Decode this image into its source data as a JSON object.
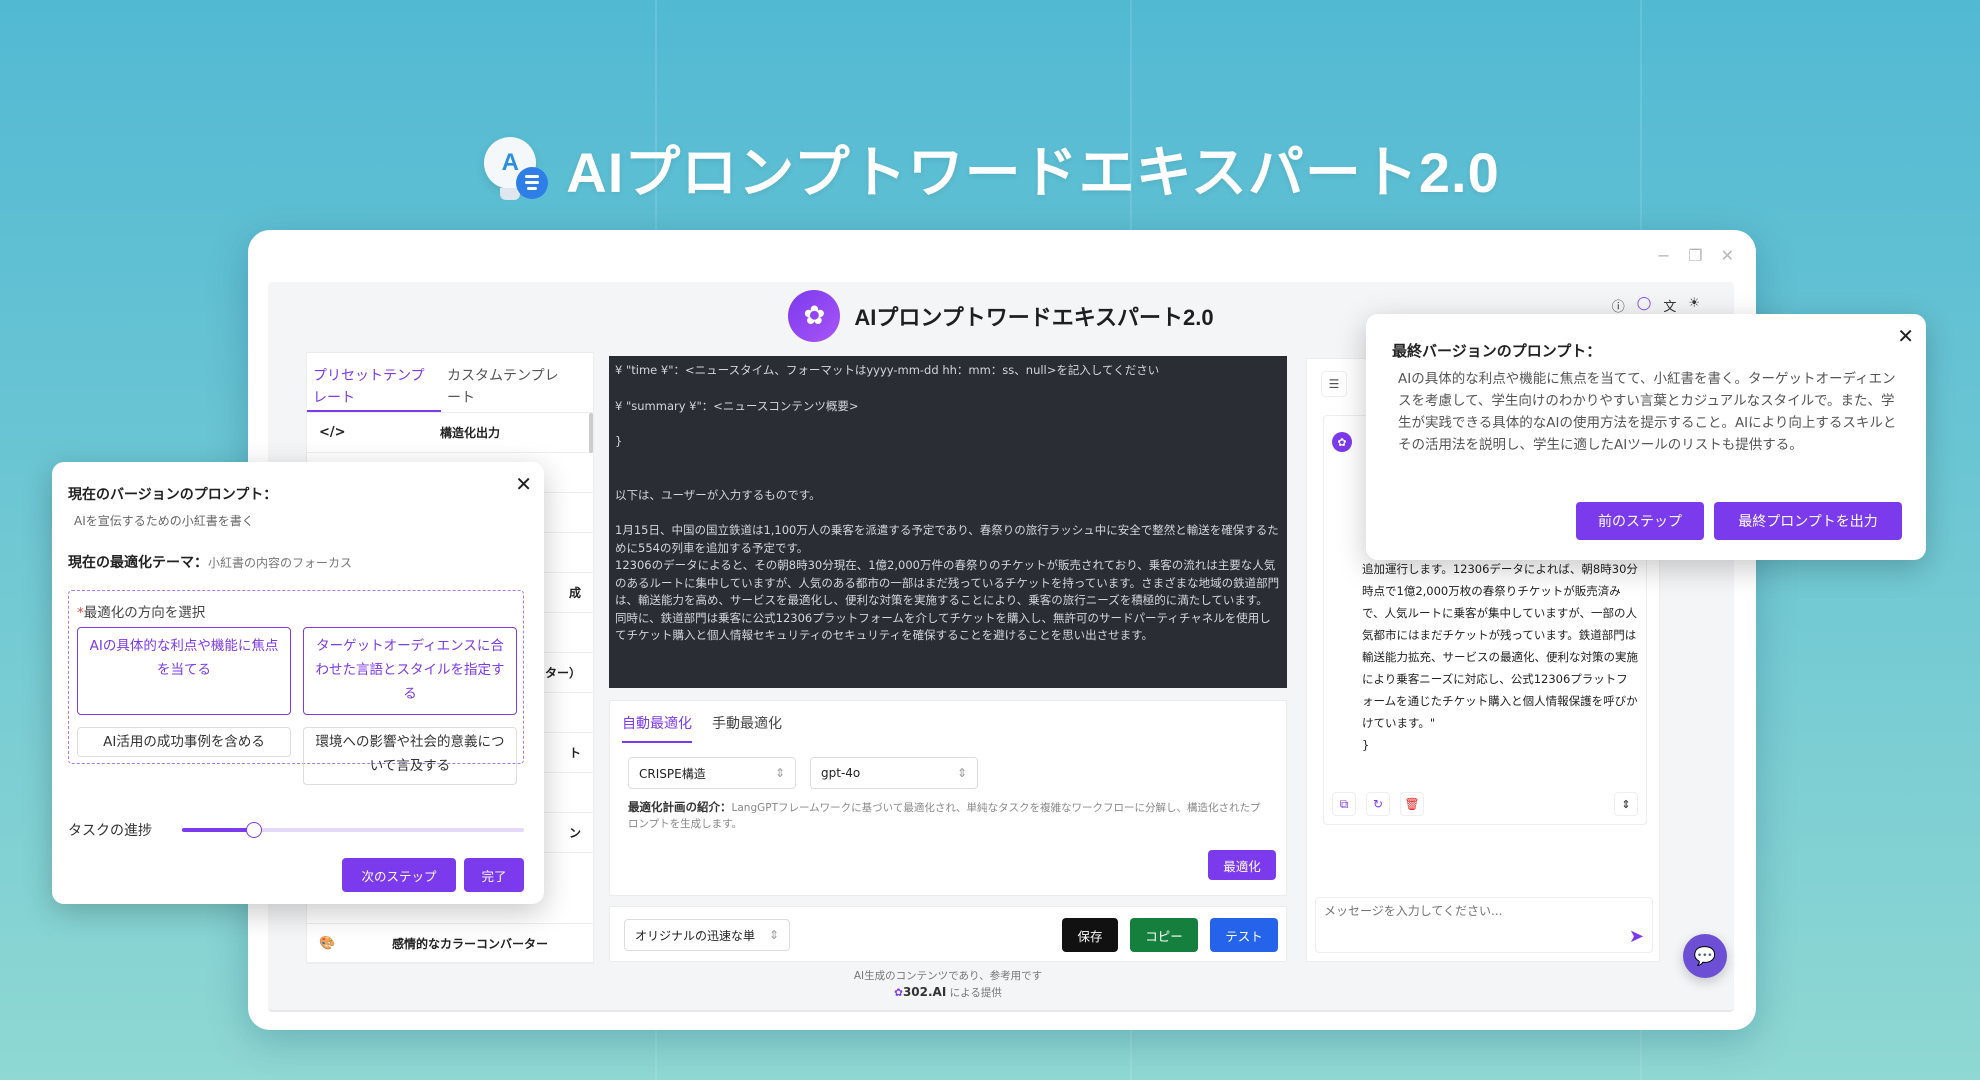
{
  "hero": {
    "title": "AIプロンプトワードエキスパート2.0",
    "logo_letter": "A"
  },
  "window": {
    "controls": [
      "−",
      "❐",
      "✕"
    ]
  },
  "app": {
    "title": "AIプロンプトワードエキスパート2.0",
    "header_icons": [
      "ⓘ",
      "◯",
      "文",
      "☀"
    ]
  },
  "left_panel": {
    "tabs": [
      "プリセットテンプレート",
      "カスタムテンプレート"
    ],
    "items": [
      {
        "icon": "</>",
        "name": "構造化出力"
      },
      {
        "icon": "",
        "name": ""
      },
      {
        "icon": "",
        "name": ""
      },
      {
        "icon": "",
        "name": ""
      },
      {
        "icon": "",
        "name": ""
      },
      {
        "icon": "",
        "name": ""
      },
      {
        "icon": "",
        "name": ""
      },
      {
        "icon": "",
        "name": ""
      },
      {
        "icon": "",
        "name": ""
      },
      {
        "icon": "",
        "name": ""
      },
      {
        "icon": "",
        "name": ""
      },
      {
        "icon": "🎨",
        "name": "感情的なカラーコンバーター"
      }
    ],
    "partial_texts": [
      "成",
      "ター）",
      "ト",
      "ン"
    ]
  },
  "editor": {
    "lines": [
      "¥ \"time ¥\"：<ニュースタイム、フォーマットはyyyy-mm-dd hh：mm：ss、null>を記入してください",
      "",
      "¥ \"summary ¥\"：<ニュースコンテンツ概要>",
      "",
      "}",
      "",
      "",
      "以下は、ユーザーが入力するものです。",
      "",
      "1月15日、中国の国立鉄道は1,100万人の乗客を派遣する予定であり、春祭りの旅行ラッシュ中に安全で整然と輸送を確保するために554の列車を追加する予定です。",
      "12306のデータによると、その朝8時30分現在、1億2,000万件の春祭りのチケットが販売されており、乗客の流れは主要な人気のあるルートに集中していますが、人気のある都市の一部はまだ残っているチケットを持っています。さまざまな地域の鉄道部門は、輸送能力を高め、サービスを最適化し、便利な対策を実施することにより、乗客の旅行ニーズを積極的に満たしています。",
      "同時に、鉄道部門は乗客に公式12306プラットフォームを介してチケットを購入し、無許可のサードパーティチャネルを使用してチケット購入と個人情報セキュリティのセキュリティを確保することを避けることを思い出させます。"
    ]
  },
  "optimization": {
    "tabs": [
      "自動最適化",
      "手動最適化"
    ],
    "framework_select": "CRISPE構造",
    "model_select": "gpt-4o",
    "plan_label": "最適化計画の紹介：",
    "plan_text": "LangGPTフレームワークに基づいて最適化され、単純なタスクを複雑なワークフローに分解し、構造化されたプロンプトを生成します。",
    "optimize_button": "最適化"
  },
  "bottom_bar": {
    "select": "オリジナルの迅速な単",
    "save": "保存",
    "copy": "コピー",
    "test": "テスト"
  },
  "right_panel": {
    "chat_text": "追加運行します。12306データによれば、朝8時30分時点で1億2,000万枚の春祭りチケットが販売済みで、人気ルートに乗客が集中していますが、一部の人気都市にはまだチケットが残っています。鉄道部門は輸送能力拡充、サービスの最適化、便利な対策の実施により乗客ニーズに対応し、公式12306プラットフォームを通じたチケット購入と個人情報保護を呼びかけています。\"",
    "chat_closing": "}",
    "message_placeholder": "メッセージを入力してください..."
  },
  "footer": {
    "note": "AI生成のコンテンツであり、参考用です",
    "brand": "302.AI",
    "powered": "による提供"
  },
  "popup_left": {
    "title": "現在のバージョンのプロンプト：",
    "prompt": "AIを宣伝するための小紅書を書く",
    "theme_label": "現在の最適化テーマ：",
    "theme_value": "小紅書の内容のフォーカス",
    "direction_label": "最適化の方向を選択",
    "options": [
      "AIの具体的な利点や機能に焦点を当てる",
      "ターゲットオーディエンスに合わせた言語とスタイルを指定する",
      "AI活用の成功事例を含める",
      "環境への影響や社会的意義について言及する"
    ],
    "progress_label": "タスクの進捗",
    "progress_fraction": 0.21,
    "next_button": "次のステップ",
    "done_button": "完了"
  },
  "popup_right": {
    "title": "最終バージョンのプロンプト：",
    "body": "AIの具体的な利点や機能に焦点を当てて、小紅書を書く。ターゲットオーディエンスを考慮して、学生向けのわかりやすい言葉とカジュアルなスタイルで。また、学生が実践できる具体的なAIの使用方法を提示すること。AIにより向上するスキルとその活用法を説明し、学生に適したAIツールのリストも提供する。",
    "prev_button": "前のステップ",
    "final_button": "最終プロンプトを出力"
  },
  "colors": {
    "accent": "#7c3aed",
    "save": "#111111",
    "copy": "#15803d",
    "test": "#2563eb"
  }
}
